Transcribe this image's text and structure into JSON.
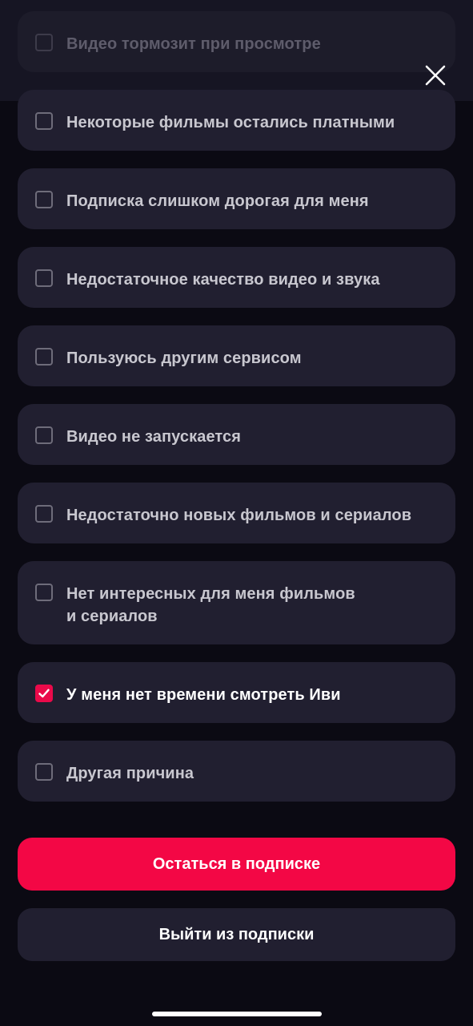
{
  "reasons": [
    {
      "label": "Видео тормозит при просмотре",
      "checked": false
    },
    {
      "label": "Некоторые фильмы остались платными",
      "checked": false
    },
    {
      "label": "Подписка слишком дорогая для меня",
      "checked": false
    },
    {
      "label": "Недостаточное качество видео и звука",
      "checked": false
    },
    {
      "label": "Пользуюсь другим сервисом",
      "checked": false
    },
    {
      "label": "Видео не запускается",
      "checked": false
    },
    {
      "label": "Недостаточно новых фильмов и сериалов",
      "checked": false
    },
    {
      "label": "Нет интересных для меня фильмов\nи сериалов",
      "checked": false
    },
    {
      "label": "У меня нет времени смотреть Иви",
      "checked": true
    },
    {
      "label": "Другая причина",
      "checked": false
    }
  ],
  "actions": {
    "stay_label": "Остаться в подписке",
    "leave_label": "Выйти из подписки"
  },
  "icons": {
    "close": "close-icon",
    "checkmark": "checkmark-icon"
  },
  "colors": {
    "accent": "#f30745",
    "card": "#211f30",
    "background": "#0b0a13"
  }
}
